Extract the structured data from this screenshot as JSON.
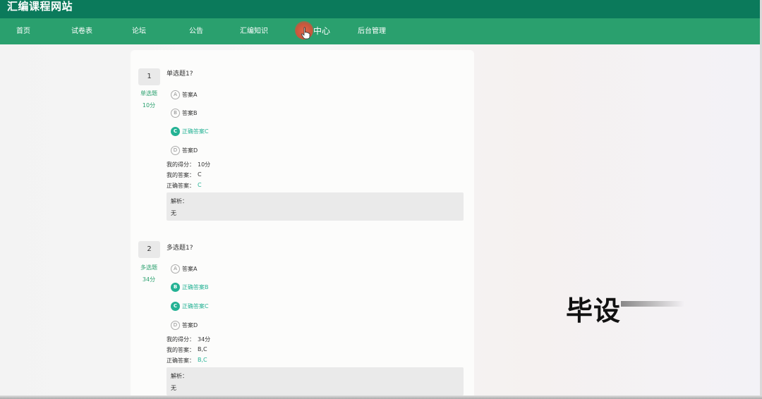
{
  "site": {
    "title": "汇编课程网站"
  },
  "nav": {
    "items": [
      {
        "label": "首页"
      },
      {
        "label": "试卷表"
      },
      {
        "label": "论坛"
      },
      {
        "label": "公告"
      },
      {
        "label": "汇编知识"
      },
      {
        "label": "中心"
      },
      {
        "label": "后台管理"
      }
    ]
  },
  "questions": [
    {
      "number": "1",
      "type": "单选题",
      "score": "10分",
      "title": "单选题1?",
      "options": [
        {
          "letter": "A",
          "text": "答案A",
          "correct": false
        },
        {
          "letter": "B",
          "text": "答案B",
          "correct": false
        },
        {
          "letter": "C",
          "text": "正确答案C",
          "correct": true
        },
        {
          "letter": "D",
          "text": "答案D",
          "correct": false
        }
      ],
      "my_score_label": "我的得分：",
      "my_score": "10分",
      "my_answer_label": "我的答案：",
      "my_answer": "C",
      "correct_answer_label": "正确答案：",
      "correct_answer": "C",
      "analysis_label": "解析：",
      "analysis": "无"
    },
    {
      "number": "2",
      "type": "多选题",
      "score": "34分",
      "title": "多选题1?",
      "options": [
        {
          "letter": "A",
          "text": "答案A",
          "correct": false
        },
        {
          "letter": "B",
          "text": "正确答案B",
          "correct": true
        },
        {
          "letter": "C",
          "text": "正确答案C",
          "correct": true
        },
        {
          "letter": "D",
          "text": "答案D",
          "correct": false
        }
      ],
      "my_score_label": "我的得分：",
      "my_score": "34分",
      "my_answer_label": "我的答案：",
      "my_answer": "B,C",
      "correct_answer_label": "正确答案：",
      "correct_answer": "B,C",
      "analysis_label": "解析：",
      "analysis": "无"
    }
  ],
  "watermark": {
    "text": "毕设"
  },
  "colors": {
    "header_dark": "#0b7a5b",
    "nav": "#2aa06e",
    "accent": "#24b294"
  }
}
